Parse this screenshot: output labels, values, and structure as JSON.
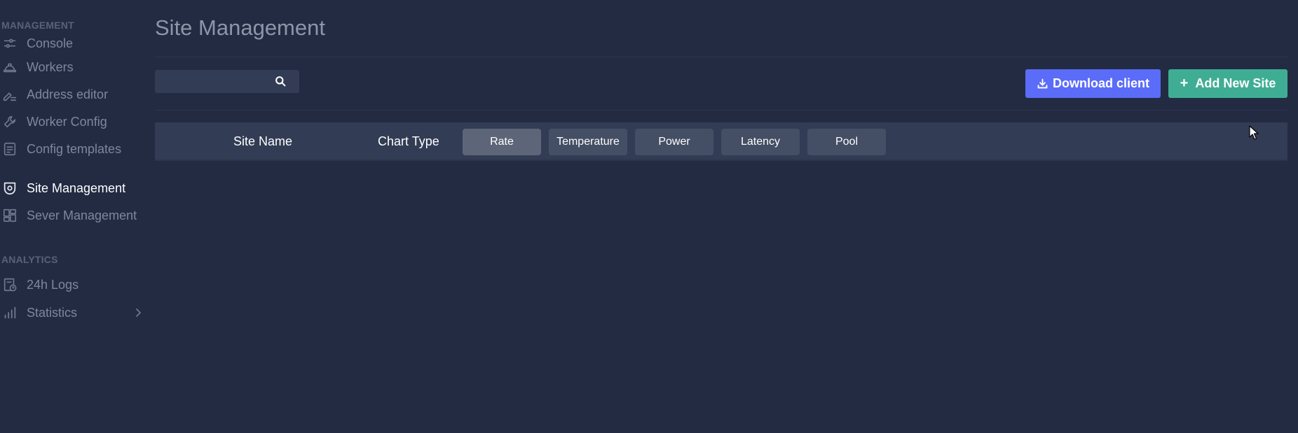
{
  "sidebar": {
    "sections": [
      {
        "title": "MANAGEMENT",
        "items": [
          {
            "label": "Console",
            "icon": "sliders-icon"
          },
          {
            "label": "Workers",
            "icon": "hard-hat-icon"
          },
          {
            "label": "Address editor",
            "icon": "edit-line-icon"
          },
          {
            "label": "Worker Config",
            "icon": "wrench-icon"
          },
          {
            "label": "Config templates",
            "icon": "document-icon"
          },
          {
            "label": "Site Management",
            "icon": "shield-icon",
            "active": true
          },
          {
            "label": "Sever Management",
            "icon": "dashboard-icon"
          }
        ]
      },
      {
        "title": "ANALYTICS",
        "items": [
          {
            "label": "24h Logs",
            "icon": "log-clock-icon"
          },
          {
            "label": "Statistics",
            "icon": "bar-chart-icon",
            "has_submenu": true
          }
        ]
      }
    ]
  },
  "main": {
    "title": "Site Management",
    "search": {
      "value": "",
      "placeholder": ""
    },
    "buttons": {
      "download": "Download client",
      "add": "Add New Site"
    },
    "table_header": {
      "site_name": "Site Name",
      "chart_type": "Chart Type",
      "chart_types": [
        "Rate",
        "Temperature",
        "Power",
        "Latency",
        "Pool"
      ],
      "selected_chart_type": "Rate"
    }
  },
  "colors": {
    "background": "#222b42",
    "panel": "#323c54",
    "primary": "#5b6cf8",
    "success": "#3fad94",
    "chip": "#444e64",
    "chip_active": "#5d6678"
  }
}
